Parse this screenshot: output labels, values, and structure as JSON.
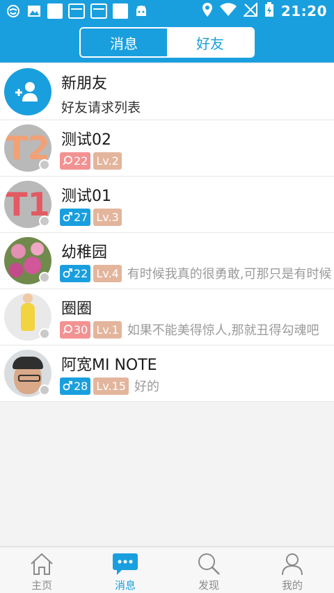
{
  "status_bar": {
    "time": "21:20"
  },
  "tabs": [
    {
      "label": "消息",
      "active": false
    },
    {
      "label": "好友",
      "active": true
    }
  ],
  "new_friend": {
    "title": "新朋友",
    "subtitle": "好友请求列表"
  },
  "friends": [
    {
      "name": "测试02",
      "gender": "female",
      "age": "22",
      "level": "Lv.2",
      "signature": "",
      "avatar_text": "T2"
    },
    {
      "name": "测试01",
      "gender": "male",
      "age": "27",
      "level": "Lv.3",
      "signature": "",
      "avatar_text": "T1"
    },
    {
      "name": "幼稚园",
      "gender": "male",
      "age": "22",
      "level": "Lv.4",
      "signature": "有时候我真的很勇敢,可那只是有时候",
      "avatar_text": ""
    },
    {
      "name": "圈圈",
      "gender": "female",
      "age": "30",
      "level": "Lv.1",
      "signature": "如果不能美得惊人,那就丑得勾魂吧",
      "avatar_text": ""
    },
    {
      "name": "阿宽MI NOTE",
      "gender": "male",
      "age": "28",
      "level": "Lv.15",
      "signature": "好的",
      "avatar_text": ""
    }
  ],
  "bottom_nav": [
    {
      "label": "主页",
      "icon": "home-icon",
      "active": false
    },
    {
      "label": "消息",
      "icon": "chat-bubble-icon",
      "active": true
    },
    {
      "label": "发现",
      "icon": "search-icon",
      "active": false
    },
    {
      "label": "我的",
      "icon": "person-icon",
      "active": false
    }
  ],
  "colors": {
    "primary": "#1a9fde",
    "female_badge": "#f39292",
    "male_badge": "#1a9fde",
    "level_badge": "#e3b59c"
  }
}
